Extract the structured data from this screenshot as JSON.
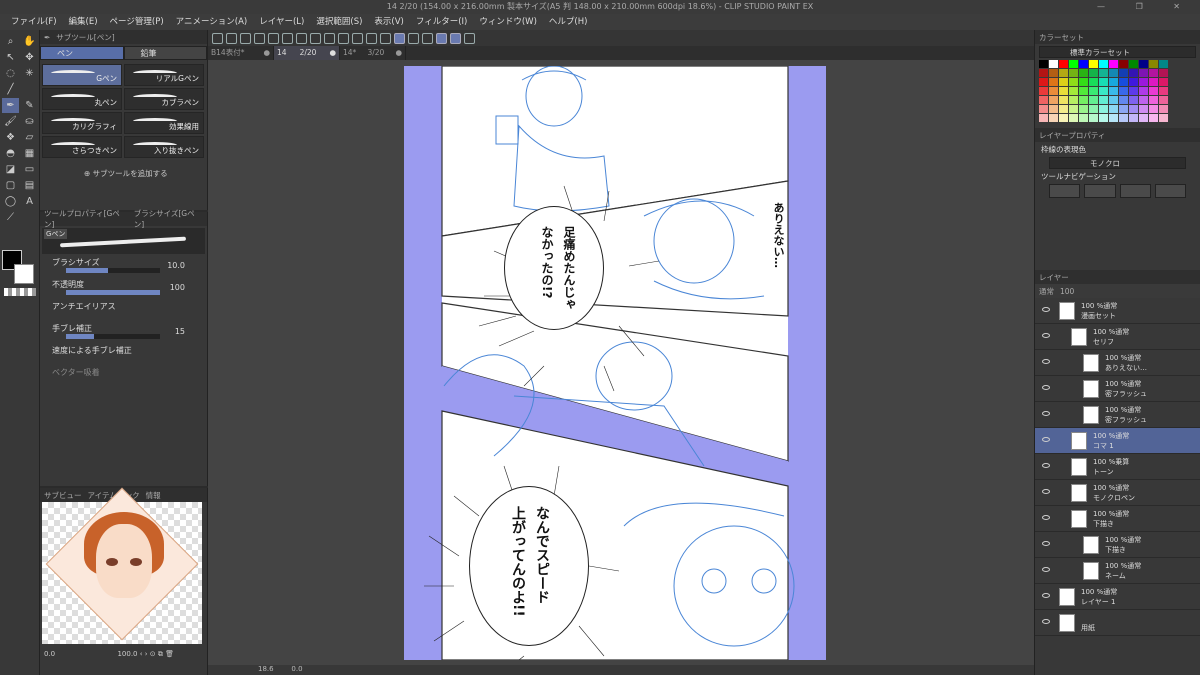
{
  "window": {
    "title": "14 2/20 (154.00 x 216.00mm 製本サイズ(A5 判 148.00 x 210.00mm 600dpi 18.6%) - CLIP STUDIO PAINT EX"
  },
  "menu": [
    "ファイル(F)",
    "編集(E)",
    "ページ管理(P)",
    "アニメーション(A)",
    "レイヤー(L)",
    "選択範囲(S)",
    "表示(V)",
    "フィルター(I)",
    "ウィンドウ(W)",
    "ヘルプ(H)"
  ],
  "tabs": [
    {
      "label": "B14表付*"
    },
    {
      "label": "14",
      "page": "2/20"
    },
    {
      "label": "14*",
      "page": "3/20"
    }
  ],
  "subtool": {
    "panel_title": "サブツール[ペン]",
    "groups": [
      "ペン",
      "鉛筆"
    ],
    "brushes": [
      "Gペン",
      "リアルGペン",
      "丸ペン",
      "カブラペン",
      "カリグラフィ",
      "効果線用",
      "さらつきペン",
      "入り抜きペン"
    ],
    "add_label": "サブツールを追加する"
  },
  "tool_property": {
    "panel_title": "ツールプロパティ[Gペン]",
    "panel_tab2": "ブラシサイズ[Gペン]",
    "preset_name": "Gペン",
    "brush_size": {
      "label": "ブラシサイズ",
      "value": "10.0",
      "level": 0.45
    },
    "opacity": {
      "label": "不透明度",
      "value": "100",
      "level": 1.0
    },
    "antialias": {
      "label": "アンチエイリアス"
    },
    "stabilize": {
      "label": "手ブレ補正",
      "value": "15",
      "level": 0.3
    },
    "speed_stabilize": "速度による手ブレ補正",
    "vector_snap": "ベクター吸着"
  },
  "subview": {
    "tabs": [
      "サブビュー",
      "アイテムバンク",
      "情報"
    ],
    "zoom": "100.0",
    "rotation": "0.0"
  },
  "status": {
    "zoom": "18.6",
    "coords": "0.0"
  },
  "manga": {
    "line1": "ありえない…",
    "balloon1": [
      "足痛めたんじゃ",
      "なかったの!?"
    ],
    "balloon2": [
      "なんでスピード",
      "上がってんのよ!!"
    ]
  },
  "color_set": {
    "panel_title": "カラーセット",
    "name": "標準カラーセット"
  },
  "layer_property": {
    "panel_title": "レイヤープロパティ",
    "effect_label": "枠線の表現色",
    "mode": "モノクロ",
    "tools_label": "ツールナビゲーション"
  },
  "layers": {
    "panel_title": "レイヤー",
    "blend": "通常",
    "opacity": "100",
    "items": [
      {
        "mode": "100 %通常",
        "name": "漫画セット",
        "indent": 0
      },
      {
        "mode": "100 %通常",
        "name": "セリフ",
        "indent": 1
      },
      {
        "mode": "100 %通常",
        "name": "ありえない…",
        "indent": 2
      },
      {
        "mode": "100 %通常",
        "name": "密フラッシュ",
        "indent": 2
      },
      {
        "mode": "100 %通常",
        "name": "密フラッシュ",
        "indent": 2
      },
      {
        "mode": "100 %通常",
        "name": "コマ 1",
        "indent": 1,
        "selected": true
      },
      {
        "mode": "100 %乗算",
        "name": "トーン",
        "indent": 1
      },
      {
        "mode": "100 %通常",
        "name": "モノクロペン",
        "indent": 1
      },
      {
        "mode": "100 %通常",
        "name": "下描き",
        "indent": 1
      },
      {
        "mode": "100 %通常",
        "name": "下描き",
        "indent": 2
      },
      {
        "mode": "100 %通常",
        "name": "ネーム",
        "indent": 2
      },
      {
        "mode": "100 %通常",
        "name": "レイヤー 1",
        "indent": 0
      },
      {
        "mode": "",
        "name": "用紙",
        "indent": 0
      }
    ]
  },
  "colors": {
    "accent": "#586ea8",
    "sketch": "#4a86d6",
    "tone": "#9b9bf0"
  }
}
